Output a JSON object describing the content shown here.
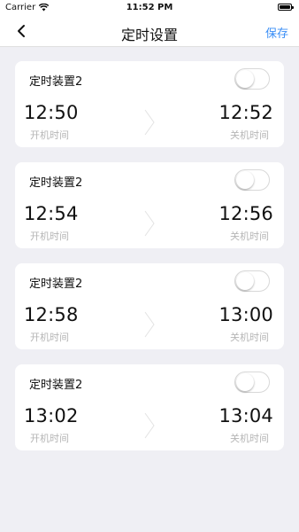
{
  "status_bar": {
    "carrier": "Carrier",
    "time": "11:52 PM"
  },
  "nav": {
    "title": "定时设置",
    "save_label": "保存"
  },
  "timers": [
    {
      "name": "定时装置2",
      "start_time": "12:50",
      "start_label": "开机时间",
      "end_time": "12:52",
      "end_label": "关机时间",
      "enabled": false
    },
    {
      "name": "定时装置2",
      "start_time": "12:54",
      "start_label": "开机时间",
      "end_time": "12:56",
      "end_label": "关机时间",
      "enabled": false
    },
    {
      "name": "定时装置2",
      "start_time": "12:58",
      "start_label": "开机时间",
      "end_time": "13:00",
      "end_label": "关机时间",
      "enabled": false
    },
    {
      "name": "定时装置2",
      "start_time": "13:02",
      "start_label": "开机时间",
      "end_time": "13:04",
      "end_label": "关机时间",
      "enabled": false
    }
  ],
  "colors": {
    "accent": "#3a8ef6",
    "background": "#efeff4",
    "card": "#ffffff",
    "muted_text": "#b5b5b5"
  },
  "icons": {
    "back": "chevron-left-icon",
    "separator": "chevron-right-icon",
    "wifi": "wifi-icon",
    "battery": "battery-icon"
  }
}
